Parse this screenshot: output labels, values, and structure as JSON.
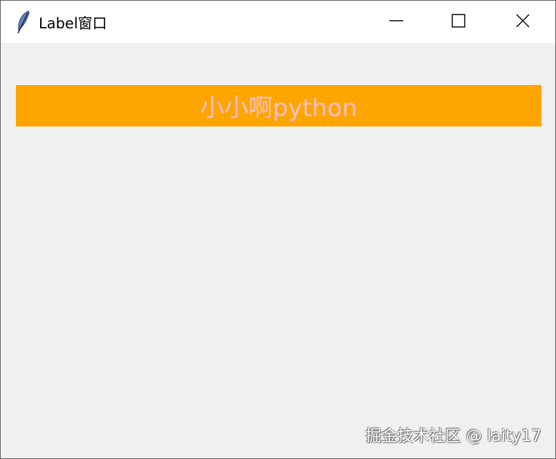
{
  "window": {
    "title": "Label窗口",
    "app_icon": "feather-icon",
    "controls": {
      "minimize_icon": "minimize-icon",
      "maximize_icon": "maximize-icon",
      "close_icon": "close-icon"
    }
  },
  "label": {
    "text": "小小啊python",
    "bg_color": "#ffa500",
    "fg_color": "#ffc0cb"
  },
  "watermark": {
    "text": "掘金技术社区 @ laity17"
  }
}
